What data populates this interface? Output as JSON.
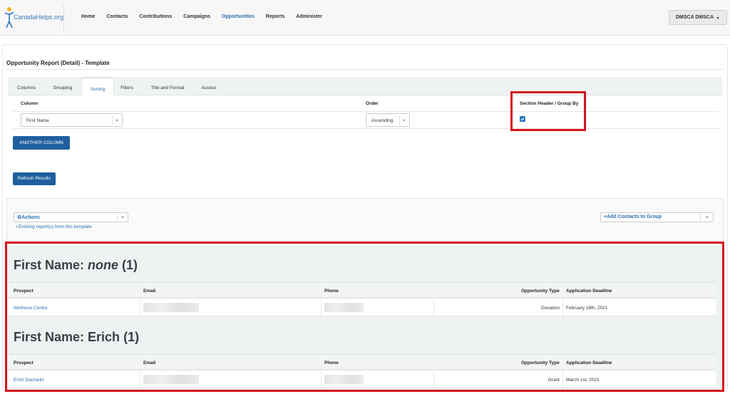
{
  "app": {
    "logo_text": "CanadaHelps.org"
  },
  "nav": {
    "items": [
      {
        "label": "Home",
        "active": false
      },
      {
        "label": "Contacts",
        "active": false
      },
      {
        "label": "Contributions",
        "active": false
      },
      {
        "label": "Campaigns",
        "active": false
      },
      {
        "label": "Opportunities",
        "active": true
      },
      {
        "label": "Reports",
        "active": false
      },
      {
        "label": "Administer",
        "active": false
      }
    ],
    "user": "DMSCA DMSCA"
  },
  "report": {
    "title": "Opportunity Report (Detail) - Template",
    "tabs": [
      "Columns",
      "Grouping",
      "Sorting",
      "Filters",
      "Title and Format",
      "Access"
    ],
    "active_tab": "Sorting"
  },
  "sorting": {
    "headers": {
      "column": "Column",
      "order": "Order",
      "section": "Section Header / Group By"
    },
    "column_value": "First Name",
    "order_value": "Ascending",
    "section_header_checked": true,
    "another_column_label": "ANOTHER COLUMN",
    "refresh_label": "Refresh Results"
  },
  "actions": {
    "actions_label": "Actions",
    "existing_link": "Existing report(s) from this template",
    "add_contacts_label": "Add Contacts to Group"
  },
  "table_headers": {
    "prospect": "Prospect",
    "email": "Email",
    "phone": "Phone",
    "opportunity_type": "Opportunity Type",
    "deadline": "Application Deadline"
  },
  "groups": [
    {
      "prefix": "First Name: ",
      "name": "none",
      "count": "(1)",
      "rows": [
        {
          "prospect": "Wellness Centre",
          "opportunity_type": "Donation",
          "deadline": "February 18th, 2021"
        }
      ]
    },
    {
      "prefix": "First Name: ",
      "name": "Erich",
      "count": "(1)",
      "rows": [
        {
          "prospect": "Erich Dachwitz",
          "opportunity_type": "Grant",
          "deadline": "March 1st, 2021"
        }
      ]
    }
  ],
  "colors": {
    "brand_blue": "#1f5f9e",
    "link_blue": "#2a6fb0",
    "highlight_red": "#d5161d"
  }
}
